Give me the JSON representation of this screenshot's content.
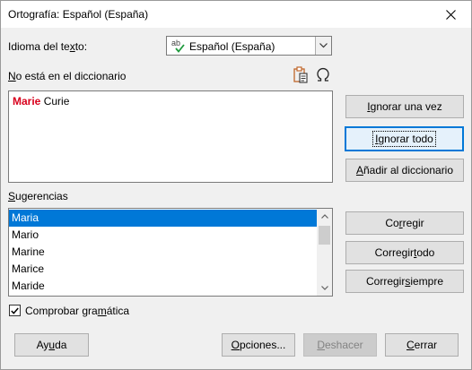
{
  "window": {
    "title": "Ortografía: Español (España)"
  },
  "language": {
    "label_pre": "Idioma del te",
    "label_accel": "x",
    "label_post": "to:",
    "value": "Español (España)"
  },
  "notindict": {
    "label_accel": "N",
    "label_post": "o está en el diccionario",
    "word": "Marie",
    "rest": " Curie"
  },
  "suggestions": {
    "label_accel": "S",
    "label_post": "ugerencias",
    "items": [
      "Maria",
      "Mario",
      "Marine",
      "Marice",
      "Maride"
    ],
    "selected_index": 0
  },
  "buttons": {
    "ignore_once": {
      "pre": "",
      "accel": "I",
      "post": "gnorar una vez"
    },
    "ignore_all": {
      "pre": "",
      "accel": "I",
      "post": "gnorar todo"
    },
    "add_dict": {
      "pre": "",
      "accel": "A",
      "post": "ñadir al diccionario"
    },
    "correct": {
      "pre": "Co",
      "accel": "r",
      "post": "regir"
    },
    "correct_all": {
      "pre": "Corregir ",
      "accel": "t",
      "post": "odo"
    },
    "correct_always": {
      "pre": "Corregir ",
      "accel": "s",
      "post": "iempre"
    },
    "help": {
      "pre": "Ay",
      "accel": "u",
      "post": "da"
    },
    "options": {
      "pre": "",
      "accel": "O",
      "post": "pciones..."
    },
    "undo": {
      "pre": "",
      "accel": "D",
      "post": "eshacer"
    },
    "cancel": {
      "pre": "",
      "accel": "C",
      "post": "errar"
    }
  },
  "grammar": {
    "label_pre": "Comprobar gra",
    "label_accel": "m",
    "label_post": "ática",
    "checked": true
  },
  "colors": {
    "accent": "#0078d7",
    "misspelled": "#d8001c"
  }
}
